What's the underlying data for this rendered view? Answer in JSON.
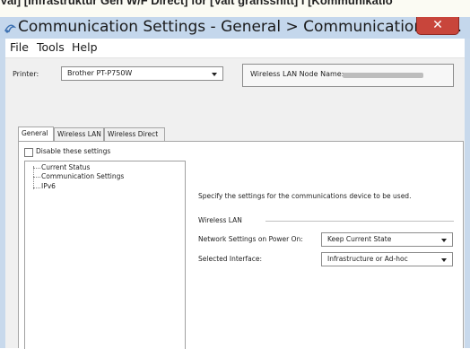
{
  "top_strip_text": "Vai] [Infrastruktur Gen W/F Direct] for [Valt gränssnitt] i [Kommunikatio",
  "window": {
    "title": "Communication Settings - General > Communication Se...",
    "close_label": "✕"
  },
  "menu": {
    "items": [
      "File",
      "Tools",
      "Help"
    ]
  },
  "printer": {
    "label": "Printer:",
    "value": "Brother PT-P750W",
    "node_name_label": "Wireless LAN Node Name:",
    "node_name_value": ""
  },
  "tabs": [
    "General",
    "Wireless LAN",
    "Wireless Direct"
  ],
  "general": {
    "disable_label": "Disable these settings",
    "disable_checked": false,
    "tree_items": [
      "Current Status",
      "Communication Settings",
      "IPv6"
    ],
    "description": "Specify the settings for the communications device to be used.",
    "section_title": "Wireless LAN",
    "fields": [
      {
        "label": "Network Settings on Power On:",
        "value": "Keep Current State"
      },
      {
        "label": "Selected Interface:",
        "value": "Infrastructure or Ad-hoc"
      }
    ]
  },
  "colors": {
    "titlebar": "#c4d7ec",
    "close_button": "#c8453b",
    "dialog_background": "#f0f0f0"
  }
}
